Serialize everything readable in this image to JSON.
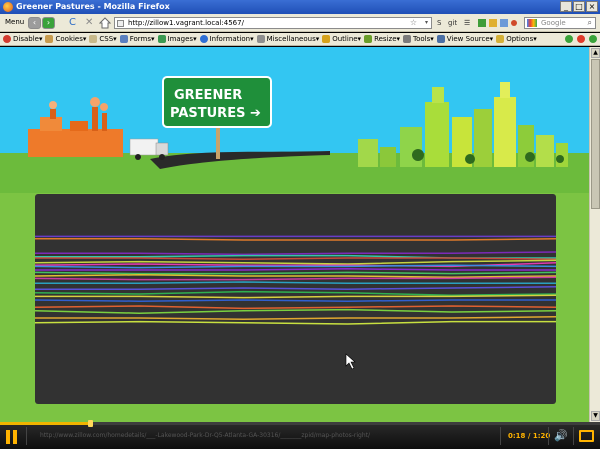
{
  "window": {
    "title": "Greener Pastures - Mozilla Firefox",
    "controls": [
      "_",
      "□",
      "×"
    ]
  },
  "nav": {
    "menu_label": "Menu",
    "back_glyph": "‹",
    "forward_glyph": "›",
    "reload_glyph": "C",
    "stop_glyph": "✕",
    "url": "http://zillow1.vagrant.local:4567/",
    "star_glyph": "☆",
    "dropdown_glyph": "▾",
    "extensions": [
      "S",
      "git",
      "☰"
    ],
    "search_placeholder": "Google",
    "search_glyph": "⌕"
  },
  "devtoolbar": {
    "items": [
      {
        "label": "Disable▾",
        "icon": "no-icon",
        "color": "#d23b2f"
      },
      {
        "label": "Cookies▾",
        "icon": "cookie-icon",
        "color": "#c79b4e"
      },
      {
        "label": "CSS▾",
        "icon": "css-icon",
        "color": "#c8b98a"
      },
      {
        "label": "Forms▾",
        "icon": "form-icon",
        "color": "#5a7fbf"
      },
      {
        "label": "Images▾",
        "icon": "image-icon",
        "color": "#3b9a52"
      },
      {
        "label": "Information▾",
        "icon": "info-icon",
        "color": "#2f6fd4"
      },
      {
        "label": "Miscellaneous▾",
        "icon": "misc-icon",
        "color": "#8f8f8f"
      },
      {
        "label": "Outline▾",
        "icon": "pencil-icon",
        "color": "#d6a21b"
      },
      {
        "label": "Resize▾",
        "icon": "resize-icon",
        "color": "#6a9e2a"
      },
      {
        "label": "Tools▾",
        "icon": "wrench-icon",
        "color": "#7b7b7b"
      },
      {
        "label": "View Source▾",
        "icon": "source-icon",
        "color": "#4a6fa5"
      },
      {
        "label": "Options▾",
        "icon": "options-icon",
        "color": "#d4b038"
      }
    ],
    "status": [
      {
        "icon": "check-icon",
        "color": "#3aa23a"
      },
      {
        "icon": "warning-icon",
        "color": "#e03a2a"
      },
      {
        "icon": "ok-icon",
        "color": "#3aa23a"
      }
    ]
  },
  "banner": {
    "sign_line1": "GREENER",
    "sign_line2": "PASTURES",
    "sign_arrow": "➔"
  },
  "chart_data": {
    "type": "line",
    "x": [
      0,
      1,
      2,
      3,
      4,
      5
    ],
    "series": [
      {
        "color": "#6a3cc8",
        "values": [
          0.02,
          0.02,
          0.02,
          0.02,
          0.02,
          0.02
        ]
      },
      {
        "color": "#e07b2a",
        "values": [
          0.04,
          0.04,
          0.05,
          0.05,
          0.05,
          0.04
        ]
      },
      {
        "color": "#7c2ab8",
        "values": [
          0.16,
          0.16,
          0.17,
          0.16,
          0.16,
          0.15
        ]
      },
      {
        "color": "#32c8a8",
        "values": [
          0.19,
          0.19,
          0.18,
          0.18,
          0.2,
          0.2
        ]
      },
      {
        "color": "#c94a3a",
        "values": [
          0.2,
          0.2,
          0.21,
          0.2,
          0.2,
          0.21
        ]
      },
      {
        "color": "#c6d440",
        "values": [
          0.24,
          0.23,
          0.24,
          0.25,
          0.23,
          0.22
        ]
      },
      {
        "color": "#e03ab0",
        "values": [
          0.26,
          0.25,
          0.26,
          0.26,
          0.27,
          0.24
        ]
      },
      {
        "color": "#3a8de0",
        "values": [
          0.27,
          0.28,
          0.27,
          0.27,
          0.26,
          0.27
        ]
      },
      {
        "color": "#8a2ad0",
        "values": [
          0.3,
          0.3,
          0.3,
          0.29,
          0.3,
          0.3
        ]
      },
      {
        "color": "#44c060",
        "values": [
          0.32,
          0.33,
          0.33,
          0.32,
          0.33,
          0.32
        ]
      },
      {
        "color": "#e0c030",
        "values": [
          0.35,
          0.34,
          0.35,
          0.35,
          0.36,
          0.35
        ]
      },
      {
        "color": "#c63aa0",
        "values": [
          0.37,
          0.38,
          0.38,
          0.37,
          0.37,
          0.36
        ]
      },
      {
        "color": "#2aa0c0",
        "values": [
          0.41,
          0.41,
          0.4,
          0.41,
          0.41,
          0.41
        ]
      },
      {
        "color": "#5a50d8",
        "values": [
          0.46,
          0.46,
          0.45,
          0.46,
          0.45,
          0.44
        ]
      },
      {
        "color": "#30b050",
        "values": [
          0.49,
          0.5,
          0.48,
          0.49,
          0.51,
          0.5
        ]
      },
      {
        "color": "#d8d040",
        "values": [
          0.52,
          0.52,
          0.53,
          0.52,
          0.52,
          0.51
        ]
      },
      {
        "color": "#3060d0",
        "values": [
          0.55,
          0.56,
          0.55,
          0.56,
          0.55,
          0.55
        ]
      },
      {
        "color": "#e06030",
        "values": [
          0.61,
          0.6,
          0.62,
          0.61,
          0.6,
          0.61
        ]
      },
      {
        "color": "#7ad040",
        "values": [
          0.64,
          0.66,
          0.64,
          0.63,
          0.65,
          0.64
        ]
      },
      {
        "color": "#e0a830",
        "values": [
          0.7,
          0.7,
          0.71,
          0.7,
          0.7,
          0.69
        ]
      },
      {
        "color": "#c8e040",
        "values": [
          0.74,
          0.73,
          0.74,
          0.75,
          0.73,
          0.73
        ]
      }
    ],
    "ylim": [
      0,
      1
    ],
    "grid": false,
    "legend": "none"
  },
  "video": {
    "progress": 0.15,
    "status_url": "http://www.zillow.com/homedetails/___-Lakewood-Park-Dr-Q5-Atlanta-GA-30316/_______zpid/map-photos-right/",
    "time": "0:18 / 1:20"
  }
}
